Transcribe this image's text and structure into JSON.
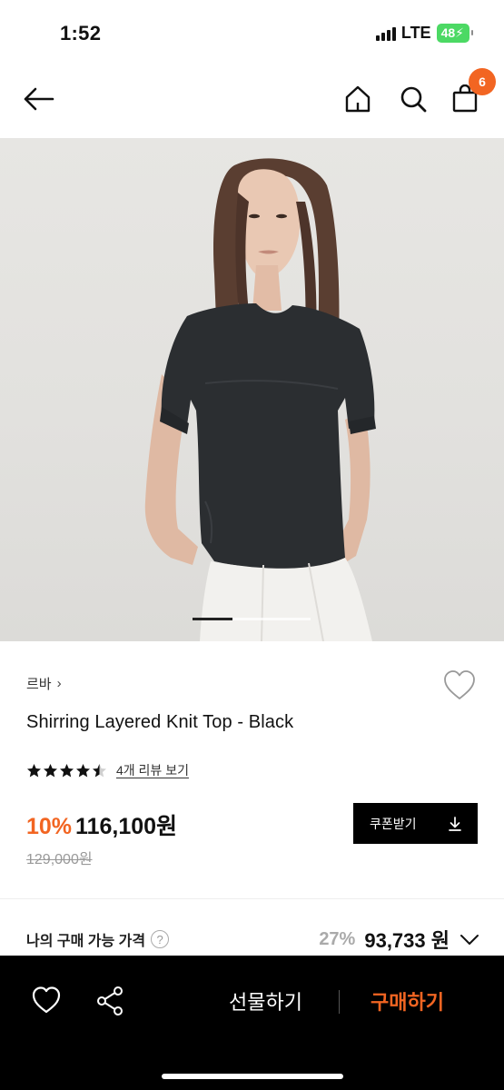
{
  "status": {
    "time": "1:52",
    "network": "LTE",
    "battery": "48"
  },
  "nav": {
    "icons": [
      "back-arrow-icon",
      "home-icon",
      "search-icon",
      "shopping-bag-icon"
    ],
    "cart_count": "6"
  },
  "product": {
    "brand": "르바",
    "name": "Shirring Layered Knit Top - Black",
    "rating": 4.5,
    "rating_max": 5,
    "review_link": "4개 리뷰 보기",
    "discount": "10%",
    "price": "116,100원",
    "original_price": "129,000원",
    "coupon_label": "쿠폰받기",
    "image_page": 1,
    "image_count": 3
  },
  "my_price": {
    "label": "나의 구매 가능 가격",
    "help": "?",
    "discount": "27%",
    "price": "93,733 원"
  },
  "bottom_bar": {
    "gift_label": "선물하기",
    "buy_label": "구매하기"
  },
  "colors": {
    "accent": "#f26522",
    "bar_bg": "#000000"
  }
}
